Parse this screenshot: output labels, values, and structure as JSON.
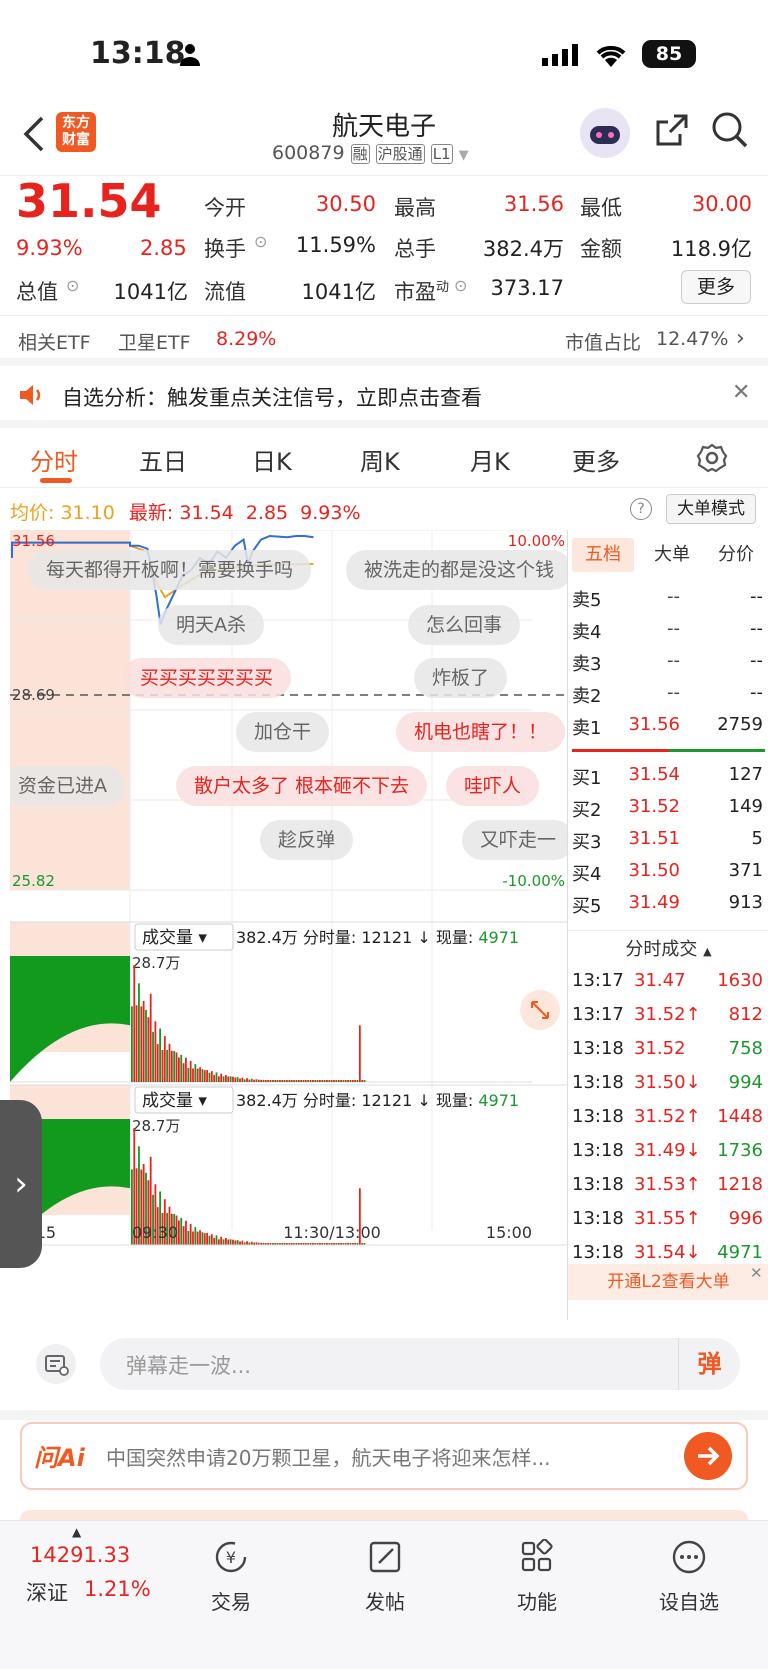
{
  "status_bar": {
    "time": "13:18",
    "battery": "85"
  },
  "header": {
    "title": "航天电子",
    "code": "600879",
    "tags": [
      "融",
      "沪股通",
      "L1"
    ],
    "logo_text": "东方财富"
  },
  "quote": {
    "price": "31.54",
    "change_pct": "9.93%",
    "change": "2.85",
    "open_label": "今开",
    "open": "30.50",
    "high_label": "最高",
    "high": "31.56",
    "low_label": "最低",
    "low": "30.00",
    "turnover_label": "换手",
    "turnover": "11.59%",
    "volume_label": "总手",
    "volume": "382.4万",
    "amount_label": "金额",
    "amount": "118.9亿",
    "mktcap_label": "总值",
    "mktcap": "1041亿",
    "float_label": "流值",
    "float_cap": "1041亿",
    "pe_label": "市盈",
    "pe_sup": "动",
    "pe": "373.17",
    "more": "更多"
  },
  "etf": {
    "label": "相关ETF",
    "name": "卫星ETF",
    "pct": "8.29%",
    "ratio_label": "市值占比",
    "ratio": "12.47%"
  },
  "notice": {
    "text": "自选分析：触发重点关注信号，立即点击查看"
  },
  "tabs": [
    "分时",
    "五日",
    "日K",
    "周K",
    "月K",
    "更多"
  ],
  "chart_info": {
    "avg_label": "均价:",
    "avg": "31.10",
    "last_label": "最新:",
    "last": "31.54",
    "chg": "2.85",
    "pct": "9.93%",
    "big_order_mode": "大单模式"
  },
  "chart_data": {
    "type": "line",
    "x_ticks": [
      "09:15",
      "09:30",
      "11:30/13:00",
      "15:00"
    ],
    "y_top": "31.56",
    "y_mid": "28.69",
    "y_bottom": "25.82",
    "pct_top": "10.00%",
    "pct_bottom": "-10.00%",
    "ylim": [
      25.82,
      31.56
    ],
    "price_series": [
      [
        0,
        31.4
      ],
      [
        2,
        31.4
      ],
      [
        4,
        31.35
      ],
      [
        6,
        30.6
      ],
      [
        7,
        30.1
      ],
      [
        8,
        30.3
      ],
      [
        10,
        30.6
      ],
      [
        12,
        30.9
      ],
      [
        14,
        31.0
      ],
      [
        16,
        31.2
      ],
      [
        18,
        31.1
      ],
      [
        20,
        31.3
      ],
      [
        22,
        31.2
      ],
      [
        24,
        31.4
      ],
      [
        26,
        31.5
      ],
      [
        27,
        31.1
      ],
      [
        28,
        31.3
      ],
      [
        30,
        31.5
      ],
      [
        32,
        31.56
      ],
      [
        34,
        31.55
      ],
      [
        36,
        31.54
      ],
      [
        38,
        31.56
      ],
      [
        40,
        31.56
      ],
      [
        42,
        31.54
      ]
    ],
    "avg_series": [
      [
        0,
        31.4
      ],
      [
        4,
        31.3
      ],
      [
        6,
        30.8
      ],
      [
        8,
        30.55
      ],
      [
        12,
        30.75
      ],
      [
        16,
        30.92
      ],
      [
        20,
        31.0
      ],
      [
        25,
        31.05
      ],
      [
        30,
        31.08
      ],
      [
        35,
        31.09
      ],
      [
        42,
        31.1
      ]
    ],
    "volume_label": "成交量",
    "volume_total": "382.4万",
    "minute_vol_label": "分时量:",
    "minute_vol": "12121",
    "current_vol_label": "现量:",
    "current_vol": "4971",
    "vol_max": "28.7万"
  },
  "danmu": [
    "每天都得开板啊！需要换手吗",
    "被洗走的都是没这个钱",
    "明天A杀",
    "怎么回事",
    "买买买买买买买",
    "炸板了",
    "加仓干",
    "机电也瞎了！！",
    "资金已进A",
    "散户太多了 根本砸不下去",
    "哇吓人",
    "趁反弹",
    "又吓走一"
  ],
  "orderbook": {
    "tabs": [
      "五档",
      "大单",
      "分价"
    ],
    "asks": [
      {
        "label": "卖5",
        "price": "--",
        "vol": "--"
      },
      {
        "label": "卖4",
        "price": "--",
        "vol": "--"
      },
      {
        "label": "卖3",
        "price": "--",
        "vol": "--"
      },
      {
        "label": "卖2",
        "price": "--",
        "vol": "--"
      },
      {
        "label": "卖1",
        "price": "31.56",
        "vol": "2759"
      }
    ],
    "bids": [
      {
        "label": "买1",
        "price": "31.54",
        "vol": "127"
      },
      {
        "label": "买2",
        "price": "31.52",
        "vol": "149"
      },
      {
        "label": "买3",
        "price": "31.51",
        "vol": "5"
      },
      {
        "label": "买4",
        "price": "31.50",
        "vol": "371"
      },
      {
        "label": "买5",
        "price": "31.49",
        "vol": "913"
      }
    ],
    "trades_title": "分时成交",
    "trades": [
      {
        "time": "13:17",
        "price": "31.47",
        "vol": "1630",
        "color": "red",
        "dir": ""
      },
      {
        "time": "13:17",
        "price": "31.52",
        "vol": "812",
        "color": "red",
        "dir": "↑"
      },
      {
        "time": "13:18",
        "price": "31.52",
        "vol": "758",
        "color": "green",
        "dir": ""
      },
      {
        "time": "13:18",
        "price": "31.50",
        "vol": "994",
        "color": "green",
        "dir": "↓"
      },
      {
        "time": "13:18",
        "price": "31.52",
        "vol": "1448",
        "color": "red",
        "dir": "↑"
      },
      {
        "time": "13:18",
        "price": "31.49",
        "vol": "1736",
        "color": "green",
        "dir": "↓"
      },
      {
        "time": "13:18",
        "price": "31.53",
        "vol": "1218",
        "color": "red",
        "dir": "↑"
      },
      {
        "time": "13:18",
        "price": "31.55",
        "vol": "996",
        "color": "red",
        "dir": "↑"
      },
      {
        "time": "13:18",
        "price": "31.54",
        "vol": "4971",
        "color": "green",
        "dir": "↓"
      }
    ],
    "l2_promo": "开通L2查看大单"
  },
  "danmu_input": {
    "placeholder": "弹幕走一波...",
    "send_label": "弹"
  },
  "ai_bar": {
    "logo": "问Ai",
    "text": "中国突然申请20万颗卫星，航天电子将迎来怎样..."
  },
  "bottom_nav": {
    "index_value": "14291.33",
    "index_name": "深证",
    "index_pct": "1.21%",
    "items": [
      "交易",
      "发帖",
      "功能",
      "设自选"
    ]
  },
  "colors": {
    "up": "#e8231e",
    "down": "#1a9a2c",
    "accent": "#f05a22"
  }
}
